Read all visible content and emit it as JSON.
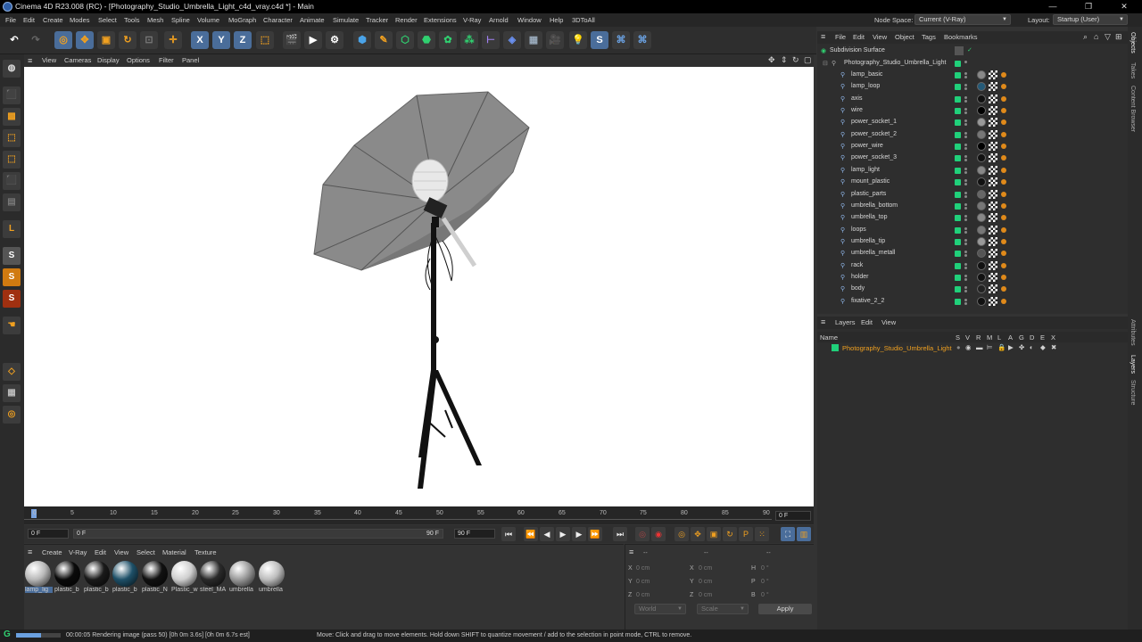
{
  "window": {
    "title": "Cinema 4D R23.008 (RC) - [Photography_Studio_Umbrella_Light_c4d_vray.c4d *] - Main"
  },
  "menus": [
    "File",
    "Edit",
    "Create",
    "Modes",
    "Select",
    "Tools",
    "Mesh",
    "Spline",
    "Volume",
    "MoGraph",
    "Character",
    "Animate",
    "Simulate",
    "Tracker",
    "Render",
    "Extensions",
    "V-Ray",
    "Arnold",
    "Window",
    "Help",
    "3DToAll"
  ],
  "node_space": {
    "label": "Node Space:",
    "value": "Current (V-Ray)"
  },
  "layout": {
    "label": "Layout:",
    "value": "Startup (User)"
  },
  "toolbar": {
    "x": "X",
    "y": "Y",
    "z": "Z"
  },
  "viewport_menu": [
    "View",
    "Cameras",
    "Display",
    "Options",
    "Filter",
    "Panel"
  ],
  "timeline": {
    "ticks": [
      "0",
      "5",
      "10",
      "15",
      "20",
      "25",
      "30",
      "35",
      "40",
      "45",
      "50",
      "55",
      "60",
      "65",
      "70",
      "75",
      "80",
      "85",
      "90"
    ],
    "current": "0 F"
  },
  "playback": {
    "start": "0 F",
    "current": "0 F",
    "end_a": "90 F",
    "end_b": "90 F"
  },
  "material_menu": [
    "Create",
    "V-Ray",
    "Edit",
    "View",
    "Select",
    "Material",
    "Texture"
  ],
  "materials": [
    {
      "label": "lamp_lig",
      "color": "#b8b8b8"
    },
    {
      "label": "plastic_b",
      "color": "#0a0a0a"
    },
    {
      "label": "plastic_b",
      "color": "#1a1a1a"
    },
    {
      "label": "plastic_b",
      "color": "#1e5068"
    },
    {
      "label": "plastic_N",
      "color": "#111111"
    },
    {
      "label": "Plastic_w",
      "color": "#cfcfcf"
    },
    {
      "label": "steel_MA",
      "color": "#2a2a2a"
    },
    {
      "label": "umbrella",
      "color": "#9a9a9a"
    },
    {
      "label": "umbrella",
      "color": "#bdbdbd"
    }
  ],
  "coords": {
    "dashes": "--",
    "rows": [
      {
        "a": "X",
        "av": "0 cm",
        "b": "X",
        "bv": "0 cm",
        "c": "H",
        "cv": "0 °"
      },
      {
        "a": "Y",
        "av": "0 cm",
        "b": "Y",
        "bv": "0 cm",
        "c": "P",
        "cv": "0 °"
      },
      {
        "a": "Z",
        "av": "0 cm",
        "b": "Z",
        "bv": "0 cm",
        "c": "B",
        "cv": "0 °"
      }
    ],
    "world": "World",
    "scale": "Scale",
    "apply": "Apply"
  },
  "status": {
    "left": "00:00:05 Rendering image (pass 50) [0h  0m  3.6s] [0h  0m  6.7s est]",
    "right": "Move: Click and drag to move elements. Hold down SHIFT to quantize movement / add to the selection in point mode, CTRL to remove."
  },
  "objects_menu": [
    "File",
    "Edit",
    "View",
    "Object",
    "Tags",
    "Bookmarks"
  ],
  "objects": {
    "root": "Subdivision Surface",
    "group": "Photography_Studio_Umbrella_Light",
    "children": [
      "lamp_basic",
      "lamp_loop",
      "axis",
      "wire",
      "power_socket_1",
      "power_socket_2",
      "power_wire",
      "power_socket_3",
      "lamp_light",
      "mount_plastic",
      "plastic_parts",
      "umbrella_bottom",
      "umbrella_top",
      "loops",
      "umbrella_tip",
      "umbrella_metall",
      "rack",
      "holder",
      "body",
      "fixative_2_2"
    ]
  },
  "layers_menu": [
    "Layers",
    "Edit",
    "View"
  ],
  "layers": {
    "name_header": "Name",
    "flags": [
      "S",
      "V",
      "R",
      "M",
      "L",
      "A",
      "G",
      "D",
      "E",
      "X"
    ],
    "layer": "Photography_Studio_Umbrella_Light"
  },
  "right_tabs": [
    "Objects",
    "Takes",
    "Content Browser",
    "Attributes",
    "Layers",
    "Structure"
  ]
}
